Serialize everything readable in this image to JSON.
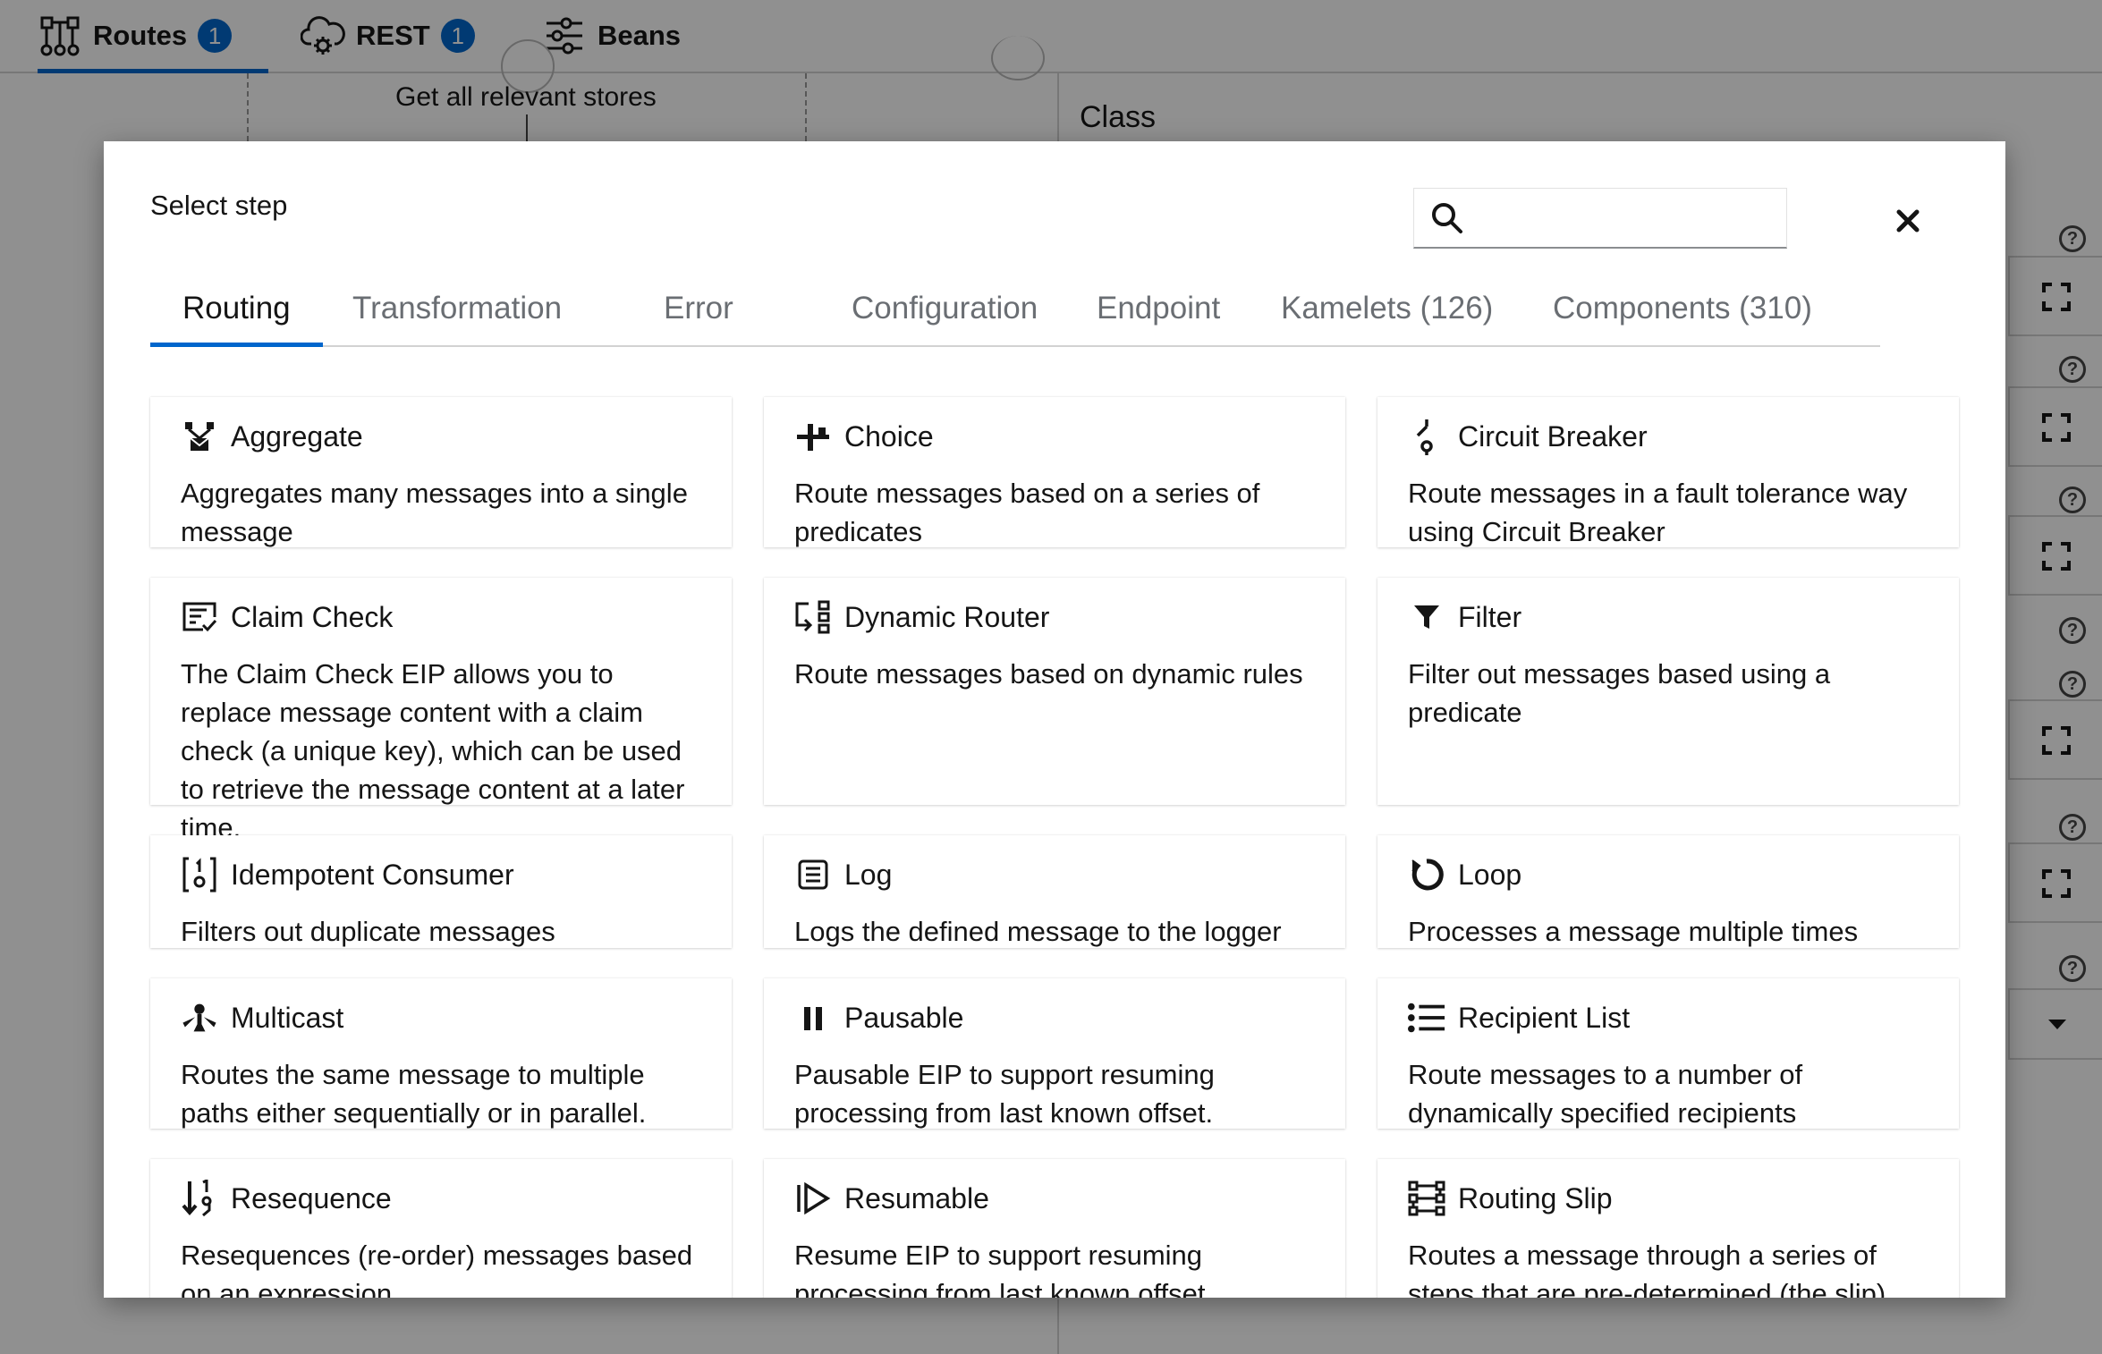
{
  "topbar": {
    "tabs": [
      {
        "label": "Routes",
        "count": "1",
        "icon": "routes-icon"
      },
      {
        "label": "REST",
        "count": "1",
        "icon": "cloud-gear-icon"
      },
      {
        "label": "Beans",
        "icon": "beans-icon"
      }
    ]
  },
  "background": {
    "node_label": "Get all relevant stores",
    "panel_title": "Class"
  },
  "modal": {
    "title": "Select step",
    "search": {
      "value": "",
      "placeholder": ""
    },
    "tabs": [
      {
        "label": "Routing",
        "active": true
      },
      {
        "label": "Transformation"
      },
      {
        "label": "Error"
      },
      {
        "label": "Configuration"
      },
      {
        "label": "Endpoint"
      },
      {
        "label": "Kamelets (126)"
      },
      {
        "label": "Components (310)"
      }
    ],
    "cards": [
      {
        "title": "Aggregate",
        "icon": "aggregate-icon",
        "description": "Aggregates many messages into a single message"
      },
      {
        "title": "Choice",
        "icon": "choice-icon",
        "description": "Route messages based on a series of predicates"
      },
      {
        "title": "Circuit Breaker",
        "icon": "circuit-breaker-icon",
        "description": "Route messages in a fault tolerance way using Circuit Breaker"
      },
      {
        "title": "Claim Check",
        "icon": "claim-check-icon",
        "description": "The Claim Check EIP allows you to replace message content with a claim check (a unique key), which can be used to retrieve the message content at a later time."
      },
      {
        "title": "Dynamic Router",
        "icon": "dynamic-router-icon",
        "description": "Route messages based on dynamic rules"
      },
      {
        "title": "Filter",
        "icon": "filter-icon",
        "description": "Filter out messages based using a predicate"
      },
      {
        "title": "Idempotent Consumer",
        "icon": "idempotent-consumer-icon",
        "description": "Filters out duplicate messages"
      },
      {
        "title": "Log",
        "icon": "log-icon",
        "description": "Logs the defined message to the logger"
      },
      {
        "title": "Loop",
        "icon": "loop-icon",
        "description": "Processes a message multiple times"
      },
      {
        "title": "Multicast",
        "icon": "multicast-icon",
        "description": "Routes the same message to multiple paths either sequentially or in parallel."
      },
      {
        "title": "Pausable",
        "icon": "pause-icon",
        "description": "Pausable EIP to support resuming processing from last known offset."
      },
      {
        "title": "Recipient List",
        "icon": "recipient-list-icon",
        "description": "Route messages to a number of dynamically specified recipients"
      },
      {
        "title": "Resequence",
        "icon": "resequence-icon",
        "description": "Resequences (re-order) messages based on an expression"
      },
      {
        "title": "Resumable",
        "icon": "resumable-icon",
        "description": "Resume EIP to support resuming processing from last known offset"
      },
      {
        "title": "Routing Slip",
        "icon": "routing-slip-icon",
        "description": "Routes a message through a series of steps that are pre-determined (the slip)"
      }
    ]
  },
  "colors": {
    "accent": "#0066cc",
    "text": "#151515",
    "muted": "#6a6e73",
    "border": "#d2d2d2"
  }
}
